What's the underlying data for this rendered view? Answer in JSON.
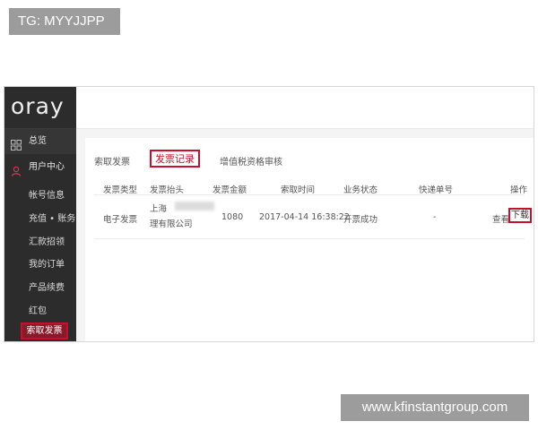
{
  "badge": {
    "text": "TG: MYYJJPP"
  },
  "logo": {
    "text": "oray"
  },
  "sidebar": {
    "overview": "总览",
    "user_center": "用户中心",
    "items": [
      "帐号信息",
      "充值 • 账务",
      "汇款招领",
      "我的订单",
      "产品续费",
      "红包"
    ],
    "active": "索取发票"
  },
  "tabs": [
    "索取发票",
    "发票记录",
    "增值税资格审核"
  ],
  "table": {
    "headers": [
      "发票类型",
      "发票抬头",
      "发票金额",
      "索取时间",
      "业务状态",
      "快递单号",
      "操作"
    ],
    "row": {
      "type": "电子发票",
      "title_line1": "上海",
      "title_line2": "理有限公司",
      "amount": "1080",
      "time": "2017-04-14 16:38:22",
      "status": "开票成功",
      "tracking": "-",
      "action_view": "查看",
      "action_download": "下载"
    }
  },
  "watermark": {
    "text": "www.kfinstantgroup.com"
  },
  "colors": {
    "accent": "#c8102e",
    "sidebar": "#2c2c2c",
    "badge": "#9c9c9c"
  }
}
